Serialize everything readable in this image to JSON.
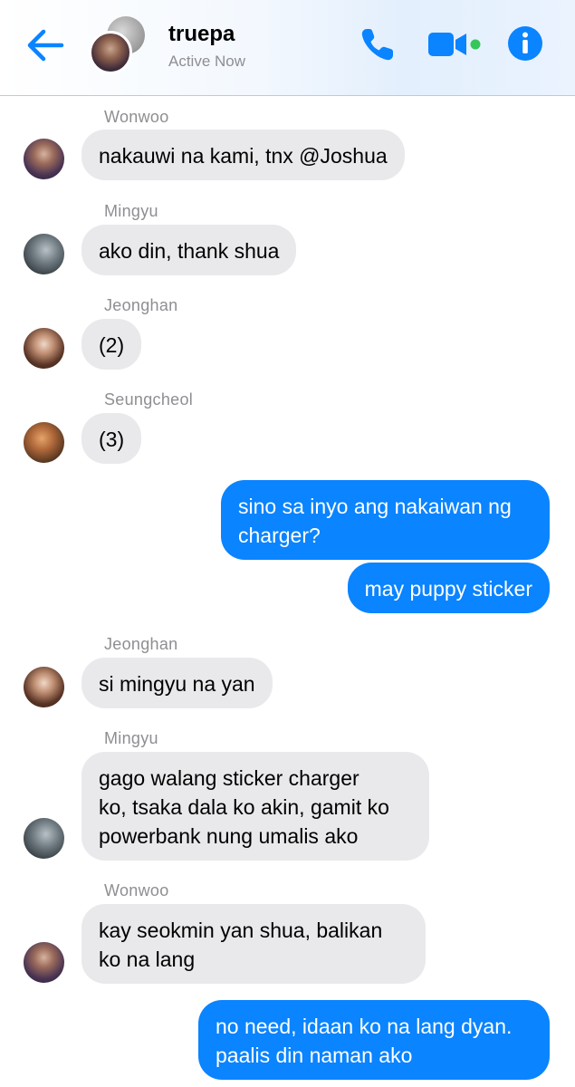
{
  "header": {
    "title": "truepa",
    "status": "Active Now",
    "colors": {
      "accent": "#0a84ff",
      "online": "#34c759"
    },
    "icons": [
      "back-arrow-icon",
      "phone-icon",
      "video-camera-icon",
      "info-icon"
    ]
  },
  "messages": [
    {
      "sender": "Wonwoo",
      "text": "nakauwi na kami, tnx @Joshua",
      "direction": "incoming"
    },
    {
      "sender": "Mingyu",
      "text": "ako din, thank shua",
      "direction": "incoming"
    },
    {
      "sender": "Jeonghan",
      "text": "(2)",
      "direction": "incoming"
    },
    {
      "sender": "Seungcheol",
      "text": "(3)",
      "direction": "incoming"
    },
    {
      "sender": "",
      "lines": [
        "sino sa inyo ang nakaiwan ng",
        "charger?"
      ],
      "direction": "outgoing"
    },
    {
      "sender": "",
      "text": "may puppy sticker",
      "direction": "outgoing"
    },
    {
      "sender": "Jeonghan",
      "text": "si mingyu na yan",
      "direction": "incoming"
    },
    {
      "sender": "Mingyu",
      "lines": [
        "gago walang sticker charger",
        "ko, tsaka dala ko akin, gamit ko",
        "powerbank nung umalis ako"
      ],
      "direction": "incoming"
    },
    {
      "sender": "Wonwoo",
      "lines": [
        "kay seokmin yan shua, balikan",
        "ko na lang"
      ],
      "direction": "incoming"
    },
    {
      "sender": "",
      "lines": [
        "no need, idaan ko na lang dyan.",
        "paalis din naman ako"
      ],
      "direction": "outgoing"
    }
  ]
}
